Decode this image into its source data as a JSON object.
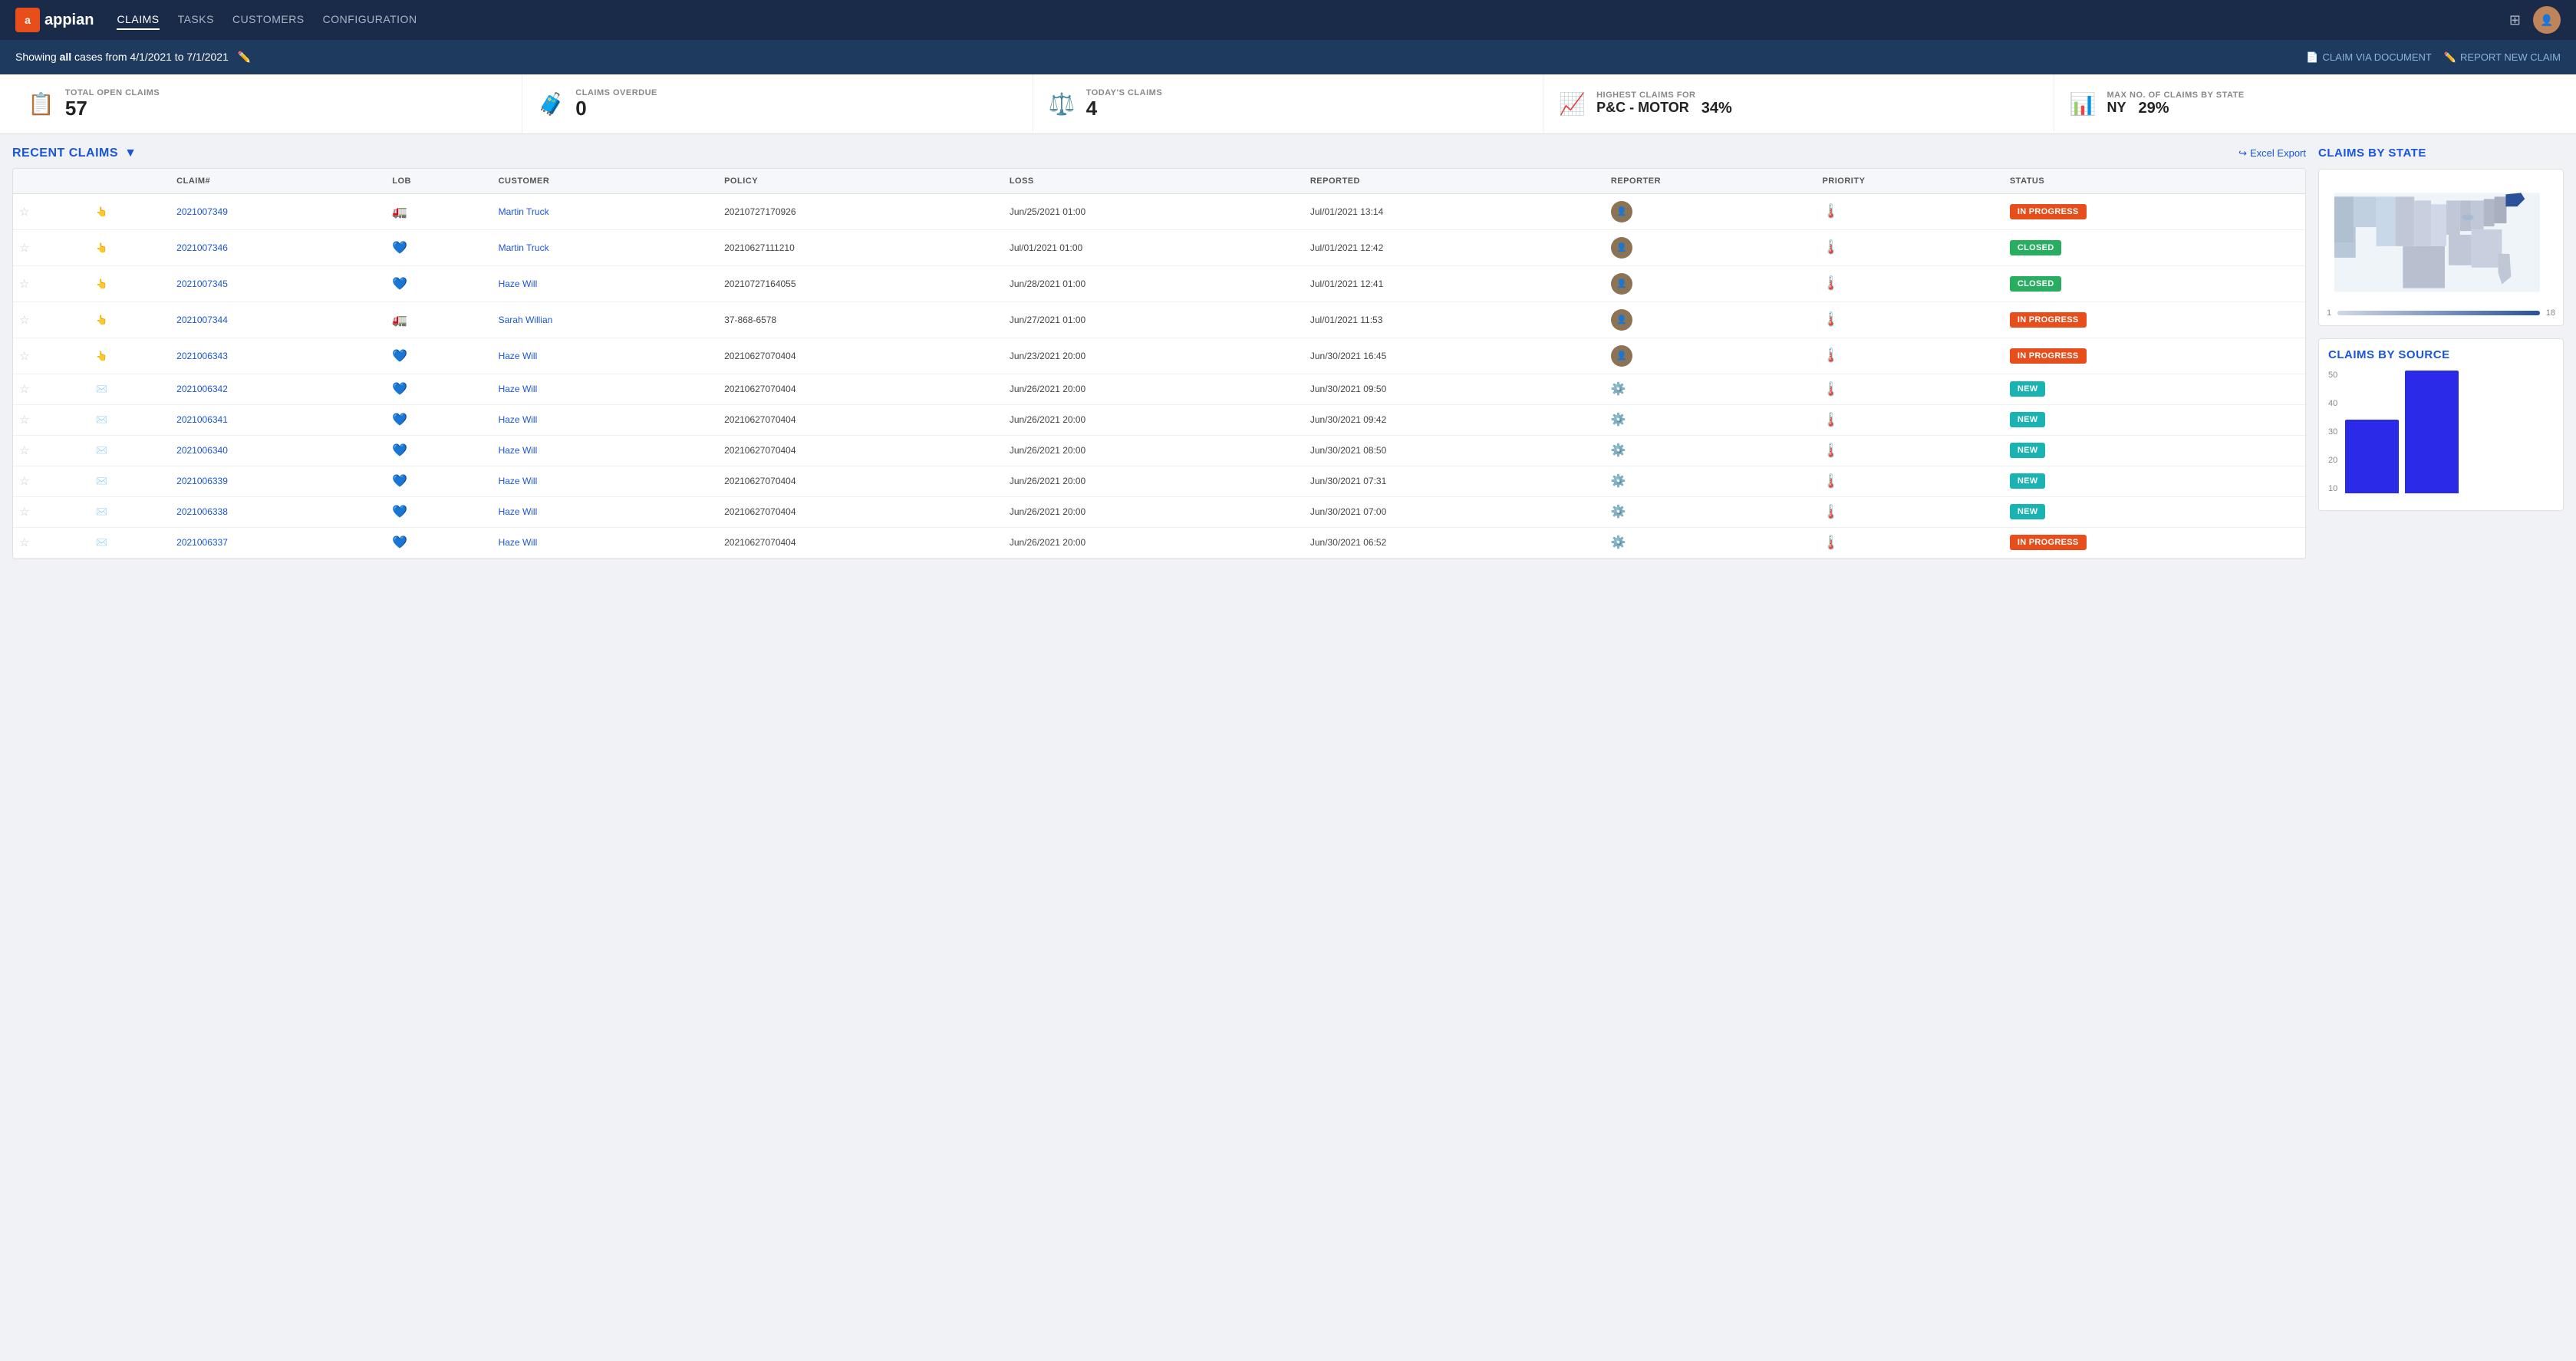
{
  "nav": {
    "logo_text": "appian",
    "items": [
      {
        "label": "CLAIMS",
        "active": true
      },
      {
        "label": "TASKS",
        "active": false
      },
      {
        "label": "CUSTOMERS",
        "active": false
      },
      {
        "label": "CONFIGURATION",
        "active": false
      }
    ],
    "filter_claim_via_doc": "CLAIM VIA DOCUMENT",
    "filter_report_new": "REPORT NEW CLAIM"
  },
  "filter_bar": {
    "prefix": "Showing",
    "bold_word": "all",
    "suffix": "cases from 4/1/2021 to 7/1/2021"
  },
  "stats": [
    {
      "icon": "📄",
      "label": "TOTAL OPEN CLAIMS",
      "value": "57",
      "extra": ""
    },
    {
      "icon": "🧳",
      "label": "CLAIMS OVERDUE",
      "value": "0",
      "extra": ""
    },
    {
      "icon": "⚖️",
      "label": "TODAY'S CLAIMS",
      "value": "4",
      "extra": ""
    },
    {
      "icon": "📈",
      "label": "HIGHEST CLAIMS FOR",
      "value": "P&C - MOTOR",
      "extra": "34%"
    },
    {
      "icon": "📊",
      "label": "MAX NO. OF CLAIMS BY STATE",
      "value": "NY",
      "extra": "29%"
    }
  ],
  "recent_claims": {
    "title": "RECENT CLAIMS",
    "excel_export": "Excel Export",
    "columns": [
      "",
      "",
      "CLAIM#",
      "LOB",
      "CUSTOMER",
      "POLICY",
      "LOSS",
      "REPORTED",
      "REPORTER",
      "PRIORITY",
      "STATUS"
    ],
    "rows": [
      {
        "star": "☆",
        "cursor": "👆",
        "claim": "2021007349",
        "lob": "truck",
        "customer": "Martin Truck",
        "policy": "20210727170926",
        "loss": "Jun/25/2021 01:00",
        "reported": "Jul/01/2021 13:14",
        "reporter": "avatar",
        "priority": "high",
        "status": "IN PROGRESS",
        "status_type": "in-progress"
      },
      {
        "star": "☆",
        "cursor": "👆",
        "claim": "2021007346",
        "lob": "health",
        "customer": "Martin Truck",
        "policy": "20210627111210",
        "loss": "Jul/01/2021 01:00",
        "reported": "Jul/01/2021 12:42",
        "reporter": "avatar",
        "priority": "low",
        "status": "CLOSED",
        "status_type": "closed"
      },
      {
        "star": "☆",
        "cursor": "👆",
        "claim": "2021007345",
        "lob": "health",
        "customer": "Haze Will",
        "policy": "20210727164055",
        "loss": "Jun/28/2021 01:00",
        "reported": "Jul/01/2021 12:41",
        "reporter": "avatar",
        "priority": "high",
        "status": "CLOSED",
        "status_type": "closed"
      },
      {
        "star": "☆",
        "cursor": "👆",
        "claim": "2021007344",
        "lob": "truck",
        "customer": "Sarah Willian",
        "policy": "37-868-6578",
        "loss": "Jun/27/2021 01:00",
        "reported": "Jul/01/2021 11:53",
        "reporter": "avatar",
        "priority": "high",
        "status": "IN PROGRESS",
        "status_type": "in-progress"
      },
      {
        "star": "☆",
        "cursor": "👆",
        "claim": "2021006343",
        "lob": "health",
        "customer": "Haze Will",
        "policy": "20210627070404",
        "loss": "Jun/23/2021 20:00",
        "reported": "Jun/30/2021 16:45",
        "reporter": "avatar",
        "priority": "low",
        "status": "IN PROGRESS",
        "status_type": "in-progress"
      },
      {
        "star": "☆",
        "cursor": "✉️",
        "claim": "2021006342",
        "lob": "health",
        "customer": "Haze Will",
        "policy": "20210627070404",
        "loss": "Jun/26/2021 20:00",
        "reported": "Jun/30/2021 09:50",
        "reporter": "gear",
        "priority": "low",
        "status": "NEW",
        "status_type": "new"
      },
      {
        "star": "☆",
        "cursor": "✉️",
        "claim": "2021006341",
        "lob": "health",
        "customer": "Haze Will",
        "policy": "20210627070404",
        "loss": "Jun/26/2021 20:00",
        "reported": "Jun/30/2021 09:42",
        "reporter": "gear",
        "priority": "low",
        "status": "NEW",
        "status_type": "new"
      },
      {
        "star": "☆",
        "cursor": "✉️",
        "claim": "2021006340",
        "lob": "health",
        "customer": "Haze Will",
        "policy": "20210627070404",
        "loss": "Jun/26/2021 20:00",
        "reported": "Jun/30/2021 08:50",
        "reporter": "gear",
        "priority": "low",
        "status": "NEW",
        "status_type": "new"
      },
      {
        "star": "☆",
        "cursor": "✉️",
        "claim": "2021006339",
        "lob": "health",
        "customer": "Haze Will",
        "policy": "20210627070404",
        "loss": "Jun/26/2021 20:00",
        "reported": "Jun/30/2021 07:31",
        "reporter": "gear",
        "priority": "low",
        "status": "NEW",
        "status_type": "new"
      },
      {
        "star": "☆",
        "cursor": "✉️",
        "claim": "2021006338",
        "lob": "health",
        "customer": "Haze Will",
        "policy": "20210627070404",
        "loss": "Jun/26/2021 20:00",
        "reported": "Jun/30/2021 07:00",
        "reporter": "gear",
        "priority": "low",
        "status": "NEW",
        "status_type": "new"
      },
      {
        "star": "☆",
        "cursor": "✉️",
        "claim": "2021006337",
        "lob": "health",
        "customer": "Haze Will",
        "policy": "20210627070404",
        "loss": "Jun/26/2021 20:00",
        "reported": "Jun/30/2021 06:52",
        "reporter": "gear",
        "priority": "low",
        "status": "IN PROGRESS",
        "status_type": "in-progress"
      }
    ]
  },
  "right_panel": {
    "claims_by_state_title": "CLAIMS BY STATE",
    "legend_min": "1",
    "legend_max": "18",
    "claims_by_source_title": "CLAIMS BY SOURCE",
    "chart_y_labels": [
      "50",
      "40",
      "30",
      "20",
      "10"
    ],
    "chart_bars": [
      {
        "height_pct": 60,
        "label": ""
      },
      {
        "height_pct": 100,
        "label": ""
      }
    ]
  }
}
